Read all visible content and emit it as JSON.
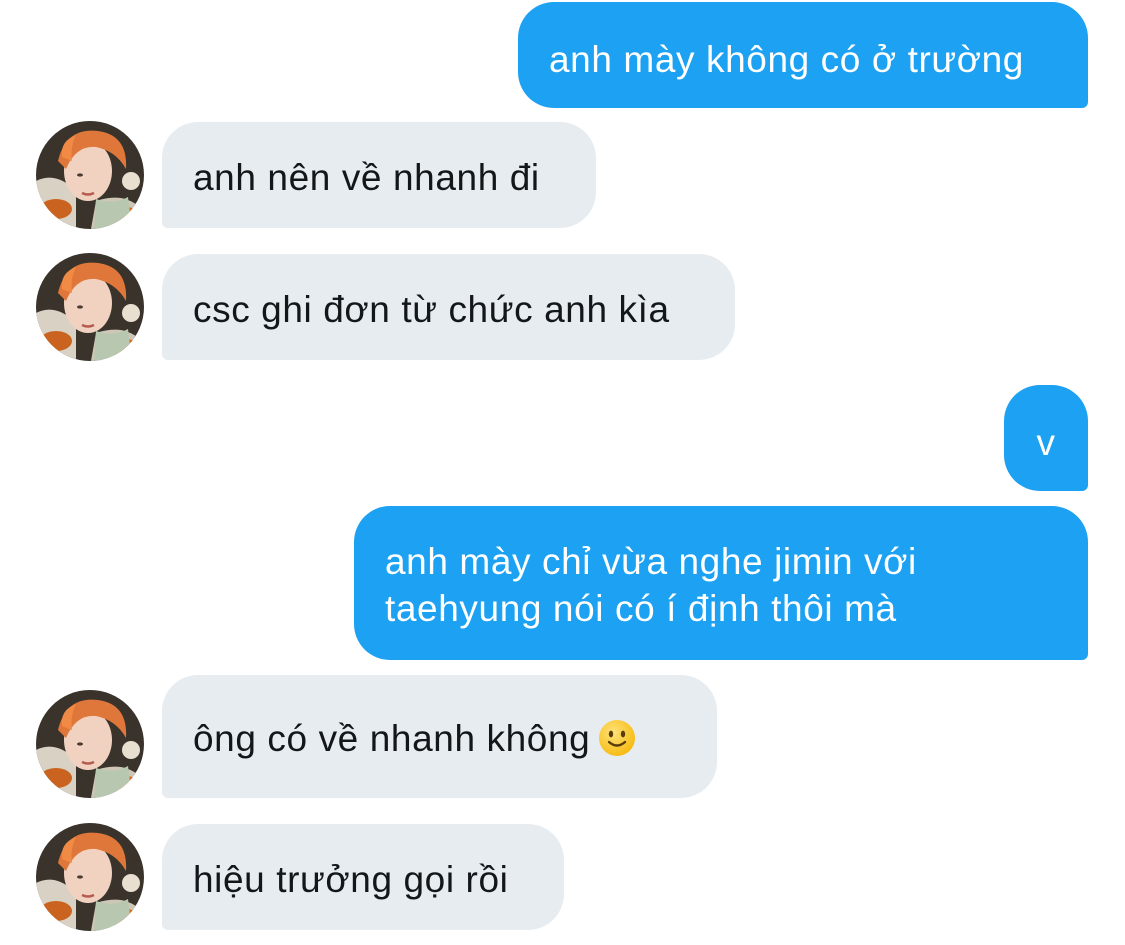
{
  "conversation": {
    "messages": [
      {
        "direction": "sent",
        "text": "anh mày không có ở trường"
      },
      {
        "direction": "received",
        "text": "anh nên về nhanh đi"
      },
      {
        "direction": "received",
        "text": "csc ghi đơn từ chức anh kìa"
      },
      {
        "direction": "sent",
        "text": "v"
      },
      {
        "direction": "sent",
        "lines": [
          "anh mày chỉ vừa nghe jimin với",
          "taehyung nói có í định thôi mà"
        ]
      },
      {
        "direction": "received",
        "text": "ông có về nhanh không",
        "emoji": "slightly-smiling-face-icon"
      },
      {
        "direction": "received",
        "text": "hiệu trưởng gọi rồi"
      }
    ]
  },
  "colors": {
    "sent_bubble": "#1da1f2",
    "received_bubble": "#e6ecf0",
    "sent_text": "#ffffff",
    "received_text": "#14171a"
  },
  "icons": {
    "avatar": "contact-avatar-photo",
    "emoji": "slightly-smiling-face-icon"
  }
}
